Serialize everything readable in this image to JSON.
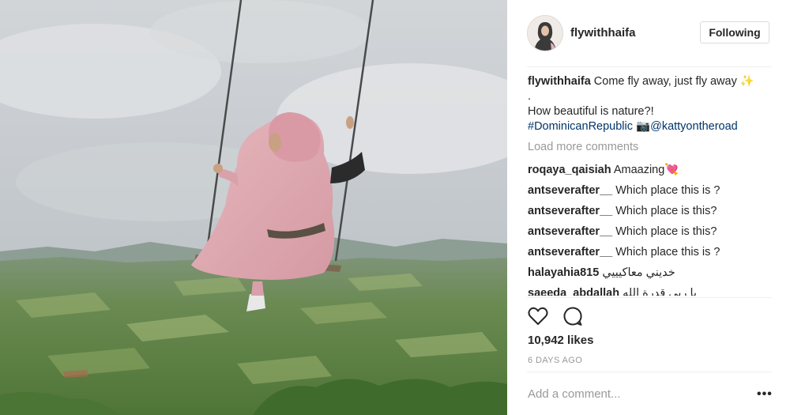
{
  "post": {
    "username": "flywithhaifa",
    "follow_label": "Following",
    "caption": {
      "username": "flywithhaifa",
      "text": "Come fly away, just fly away",
      "sparkle": "✨",
      "dot": ".",
      "line2": "How beautiful is nature?!",
      "hashtag": "#DominicanRepublic",
      "camera": "📷",
      "mention": "@kattyontheroad"
    },
    "load_more": "Load more comments",
    "comments": [
      {
        "user": "roqaya_qaisiah",
        "text": "Amaazing💘"
      },
      {
        "user": "antseverafter__",
        "text": "Which place this is ?"
      },
      {
        "user": "antseverafter__",
        "text": "Which place is this?"
      },
      {
        "user": "antseverafter__",
        "text": "Which place is this?"
      },
      {
        "user": "antseverafter__",
        "text": "Which place this is ?"
      },
      {
        "user": "halayahia815",
        "text": "خديني معاكيييي"
      },
      {
        "user": "saeeda_abdallah",
        "text": "يا ربي قدرة الله"
      }
    ],
    "likes": "10,942 likes",
    "timestamp": "6 DAYS AGO",
    "add_comment_placeholder": "Add a comment...",
    "more_label": "•••"
  },
  "icons": {
    "like": "heart-icon",
    "comment": "comment-bubble-icon",
    "more": "more-options-icon"
  },
  "colors": {
    "text": "#262626",
    "muted": "#999999",
    "link": "#003569",
    "border": "#dbdbdb"
  }
}
